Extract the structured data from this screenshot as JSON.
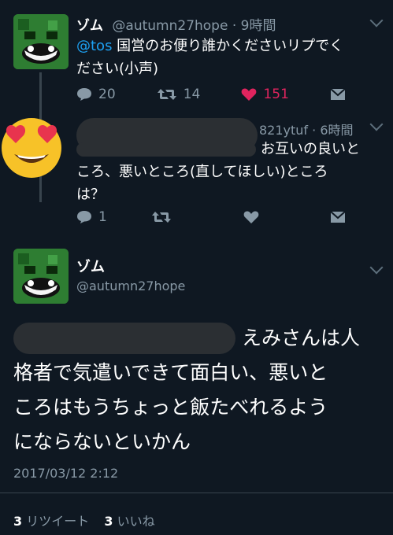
{
  "tweet1": {
    "name": "ゾム",
    "handle": "@autumn27hope",
    "sep": "·",
    "time": "9時間",
    "mention": "@tos",
    "text_line1_rest": " 国営のお便り誰かくださいリプでく",
    "text_line2": "ださい(小声)",
    "replies": "20",
    "retweets": "14",
    "likes": "151",
    "accent_like": "#e0245e"
  },
  "tweet2": {
    "handle_partial": "821ytuf",
    "sep": "·",
    "time": "6時間",
    "text_line1_end": "お互いの良いと",
    "text_line2": "ころ、悪いところ(直してほしい)ところ",
    "text_line3": "は？",
    "replies": "1",
    "emoji": "heart-eyes-emoji"
  },
  "tweet3": {
    "name": "ゾム",
    "handle": "@autumn27hope",
    "text_line1_end": "えみさんは人",
    "text_line2": "格者で気遣いできて面白い、悪いと",
    "text_line3": "ころはもうちょっと飯たべれるよう",
    "text_line4": "にならないといかん",
    "timestamp": "2017/03/12 2:12",
    "retweet_count": "3",
    "retweet_label": "リツイート",
    "like_count": "3",
    "like_label": "いいね"
  }
}
